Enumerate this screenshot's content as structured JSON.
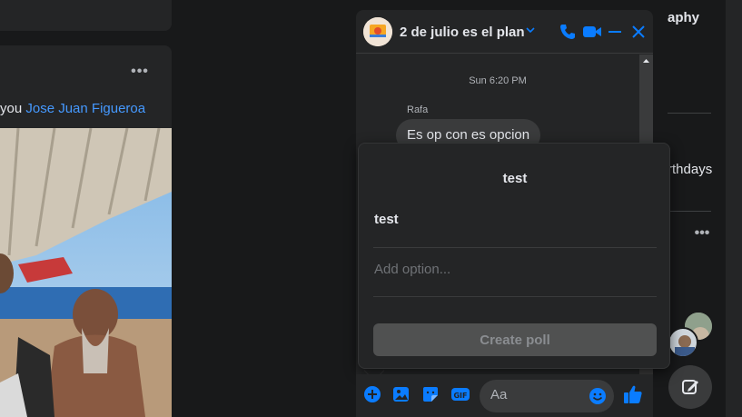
{
  "feed": {
    "tag_prefix": "you",
    "tag_name": "Jose Juan Figueroa",
    "more_label": "•••"
  },
  "right": {
    "text_top": "aphy",
    "text_birthdays": "rthdays",
    "more_label": "•••"
  },
  "chat": {
    "title": "2 de julio es el plan",
    "timestamp": "Sun 6:20 PM",
    "sender": "Rafa",
    "message": "Es op con es opcion",
    "input_placeholder": "Aa"
  },
  "poll": {
    "title": "test",
    "option_1": "test",
    "add_placeholder": "Add option...",
    "create_label": "Create poll"
  },
  "colors": {
    "accent": "#0a7cff",
    "background": "#18191a",
    "surface": "#242526"
  }
}
